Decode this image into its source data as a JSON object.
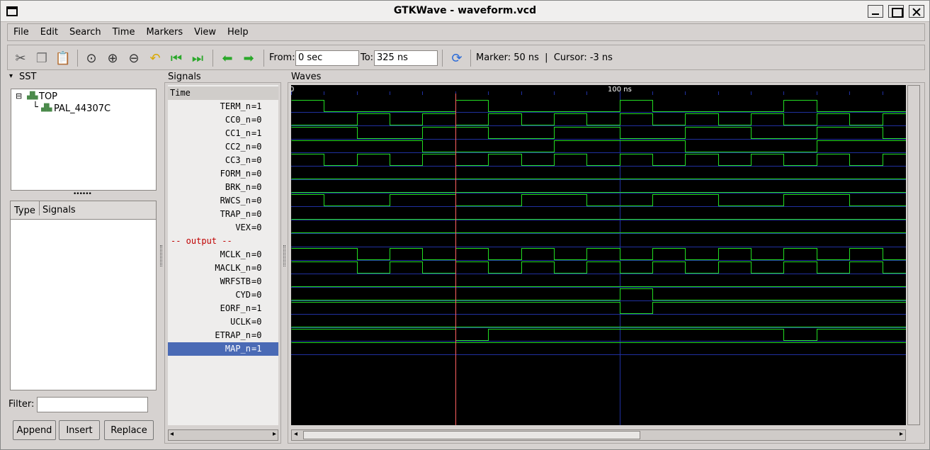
{
  "window": {
    "title": "GTKWave - waveform.vcd"
  },
  "menu": [
    "File",
    "Edit",
    "Search",
    "Time",
    "Markers",
    "View",
    "Help"
  ],
  "toolbar": {
    "icons": [
      "cut-icon",
      "copy-icon",
      "paste-icon",
      "zoom-fit-icon",
      "zoom-in-icon",
      "zoom-out-icon",
      "undo-icon",
      "zoom-to-start-icon",
      "zoom-to-end-icon",
      "find-prev-edge-icon",
      "find-next-edge-icon",
      "reload-icon"
    ],
    "from_label": "From:",
    "from_value": "0 sec",
    "to_label": "To:",
    "to_value": "325 ns",
    "marker_info": "Marker: 50 ns  |  Cursor: -3 ns"
  },
  "sst": {
    "label": "SST",
    "tree": [
      {
        "name": "TOP"
      },
      {
        "name": "PAL_44307C"
      }
    ],
    "columns": [
      "Type",
      "Signals"
    ],
    "filter_label": "Filter:",
    "filter_value": "",
    "buttons": [
      "Append",
      "Insert",
      "Replace"
    ]
  },
  "signals": {
    "label": "Signals",
    "time_header": "Time",
    "rows": [
      {
        "name": "TERM_n",
        "value": "=1"
      },
      {
        "name": "CC0_n",
        "value": "=0"
      },
      {
        "name": "CC1_n",
        "value": "=1"
      },
      {
        "name": "CC2_n",
        "value": "=0"
      },
      {
        "name": "CC3_n",
        "value": "=0"
      },
      {
        "name": "FORM_n",
        "value": "=0"
      },
      {
        "name": "BRK_n",
        "value": "=0"
      },
      {
        "name": "RWCS_n",
        "value": "=0"
      },
      {
        "name": "TRAP_n",
        "value": "=0"
      },
      {
        "name": "VEX",
        "value": "=0"
      },
      {
        "name": "-- output --",
        "value": "",
        "comment": true
      },
      {
        "name": "MCLK_n",
        "value": "=0"
      },
      {
        "name": "MACLK_n",
        "value": "=0"
      },
      {
        "name": "WRFSTB",
        "value": "=0"
      },
      {
        "name": "CYD",
        "value": "=0"
      },
      {
        "name": "EORF_n",
        "value": "=1"
      },
      {
        "name": "UCLK",
        "value": "=0"
      },
      {
        "name": "ETRAP_n",
        "value": "=0"
      },
      {
        "name": "MAP_n",
        "value": "=1",
        "selected": true
      }
    ]
  },
  "waves": {
    "label": "Waves",
    "time_start_label": "0",
    "time_mid_label": "100 ns",
    "total_ns": 187,
    "marker_ns": 50,
    "grid_ns": 100,
    "colors": {
      "trace": "#22dd22",
      "marker": "#ff6060",
      "grid": "#2030a0",
      "selected_row": "#4a6ab5"
    },
    "traces": [
      {
        "init": 1,
        "edges": [
          10,
          50,
          60,
          100,
          110,
          150,
          160
        ]
      },
      {
        "init": 0,
        "edges": [
          20,
          30,
          40,
          50,
          60,
          70,
          80,
          90,
          100,
          110,
          120,
          130,
          140,
          150,
          160,
          170,
          180
        ]
      },
      {
        "init": 1,
        "edges": [
          20,
          40,
          60,
          80,
          100,
          120,
          140,
          160,
          180
        ]
      },
      {
        "init": 1,
        "edges": [
          40,
          80,
          120,
          160
        ]
      },
      {
        "init": 1,
        "edges": [
          10,
          20,
          30,
          40,
          50,
          60,
          70,
          80,
          90,
          100,
          110,
          120,
          130,
          140,
          150,
          160,
          170,
          180
        ]
      },
      {
        "init": 0,
        "edges": []
      },
      {
        "init": 0,
        "edges": []
      },
      {
        "init": 1,
        "edges": [
          10,
          30,
          50,
          70,
          90,
          110,
          130,
          150,
          170
        ]
      },
      {
        "init": 0,
        "edges": []
      },
      {
        "init": 0,
        "edges": []
      },
      null,
      {
        "init": 1,
        "edges": [
          20,
          30,
          40,
          50,
          60,
          70,
          80,
          90,
          100,
          110,
          120,
          130,
          140,
          150,
          160,
          170,
          180
        ]
      },
      {
        "init": 1,
        "edges": [
          20,
          30,
          40,
          50,
          60,
          70,
          80,
          90,
          100,
          110,
          120,
          130,
          140,
          150,
          160,
          170,
          180
        ]
      },
      {
        "init": 0,
        "edges": []
      },
      {
        "init": 0,
        "edges": [
          100,
          110
        ]
      },
      {
        "init": 1,
        "edges": [
          100,
          110
        ]
      },
      {
        "init": 0,
        "edges": []
      },
      {
        "init": 1,
        "edges": [
          50,
          60,
          150,
          160
        ]
      },
      {
        "init": 1,
        "edges": []
      }
    ]
  }
}
